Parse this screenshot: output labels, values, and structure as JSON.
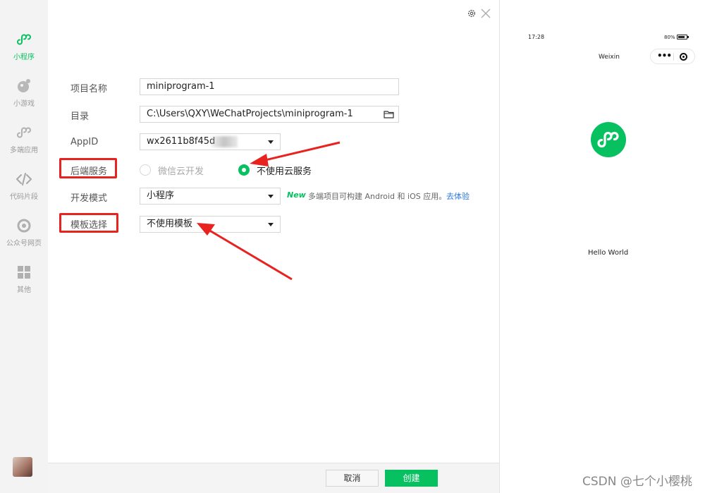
{
  "sidebar": {
    "items": [
      {
        "label": "小程序",
        "icon": "miniprogram-icon",
        "active": true
      },
      {
        "label": "小游戏",
        "icon": "minigame-icon",
        "active": false
      },
      {
        "label": "多端应用",
        "icon": "multiplatform-icon",
        "active": false
      },
      {
        "label": "代码片段",
        "icon": "code-icon",
        "active": false
      },
      {
        "label": "公众号网页",
        "icon": "official-account-icon",
        "active": false
      },
      {
        "label": "其他",
        "icon": "grid-icon",
        "active": false
      }
    ]
  },
  "form": {
    "project_name": {
      "label": "项目名称",
      "value": "miniprogram-1"
    },
    "directory": {
      "label": "目录",
      "value": "C:\\Users\\QXY\\WeChatProjects\\miniprogram-1"
    },
    "appid": {
      "label": "AppID",
      "value": "wx2611b8f45d"
    },
    "backend": {
      "label": "后端服务",
      "options": [
        {
          "label": "微信云开发",
          "selected": false,
          "disabled": true
        },
        {
          "label": "不使用云服务",
          "selected": true,
          "disabled": false
        }
      ]
    },
    "dev_mode": {
      "label": "开发模式",
      "value": "小程序",
      "new_tag": "New",
      "hint": "多端项目可构建 Android 和 iOS 应用。",
      "hint_link": "去体验"
    },
    "template": {
      "label": "模板选择",
      "value": "不使用模板"
    }
  },
  "footer": {
    "cancel_label": "取消",
    "create_label": "创建"
  },
  "preview": {
    "time": "17:28",
    "battery": "80%",
    "title": "Weixin",
    "hello": "Hello World"
  },
  "watermark": "CSDN @七个小樱桃",
  "colors": {
    "accent": "#07c160",
    "annotation": "#e8221e",
    "link": "#2a7ae2"
  }
}
